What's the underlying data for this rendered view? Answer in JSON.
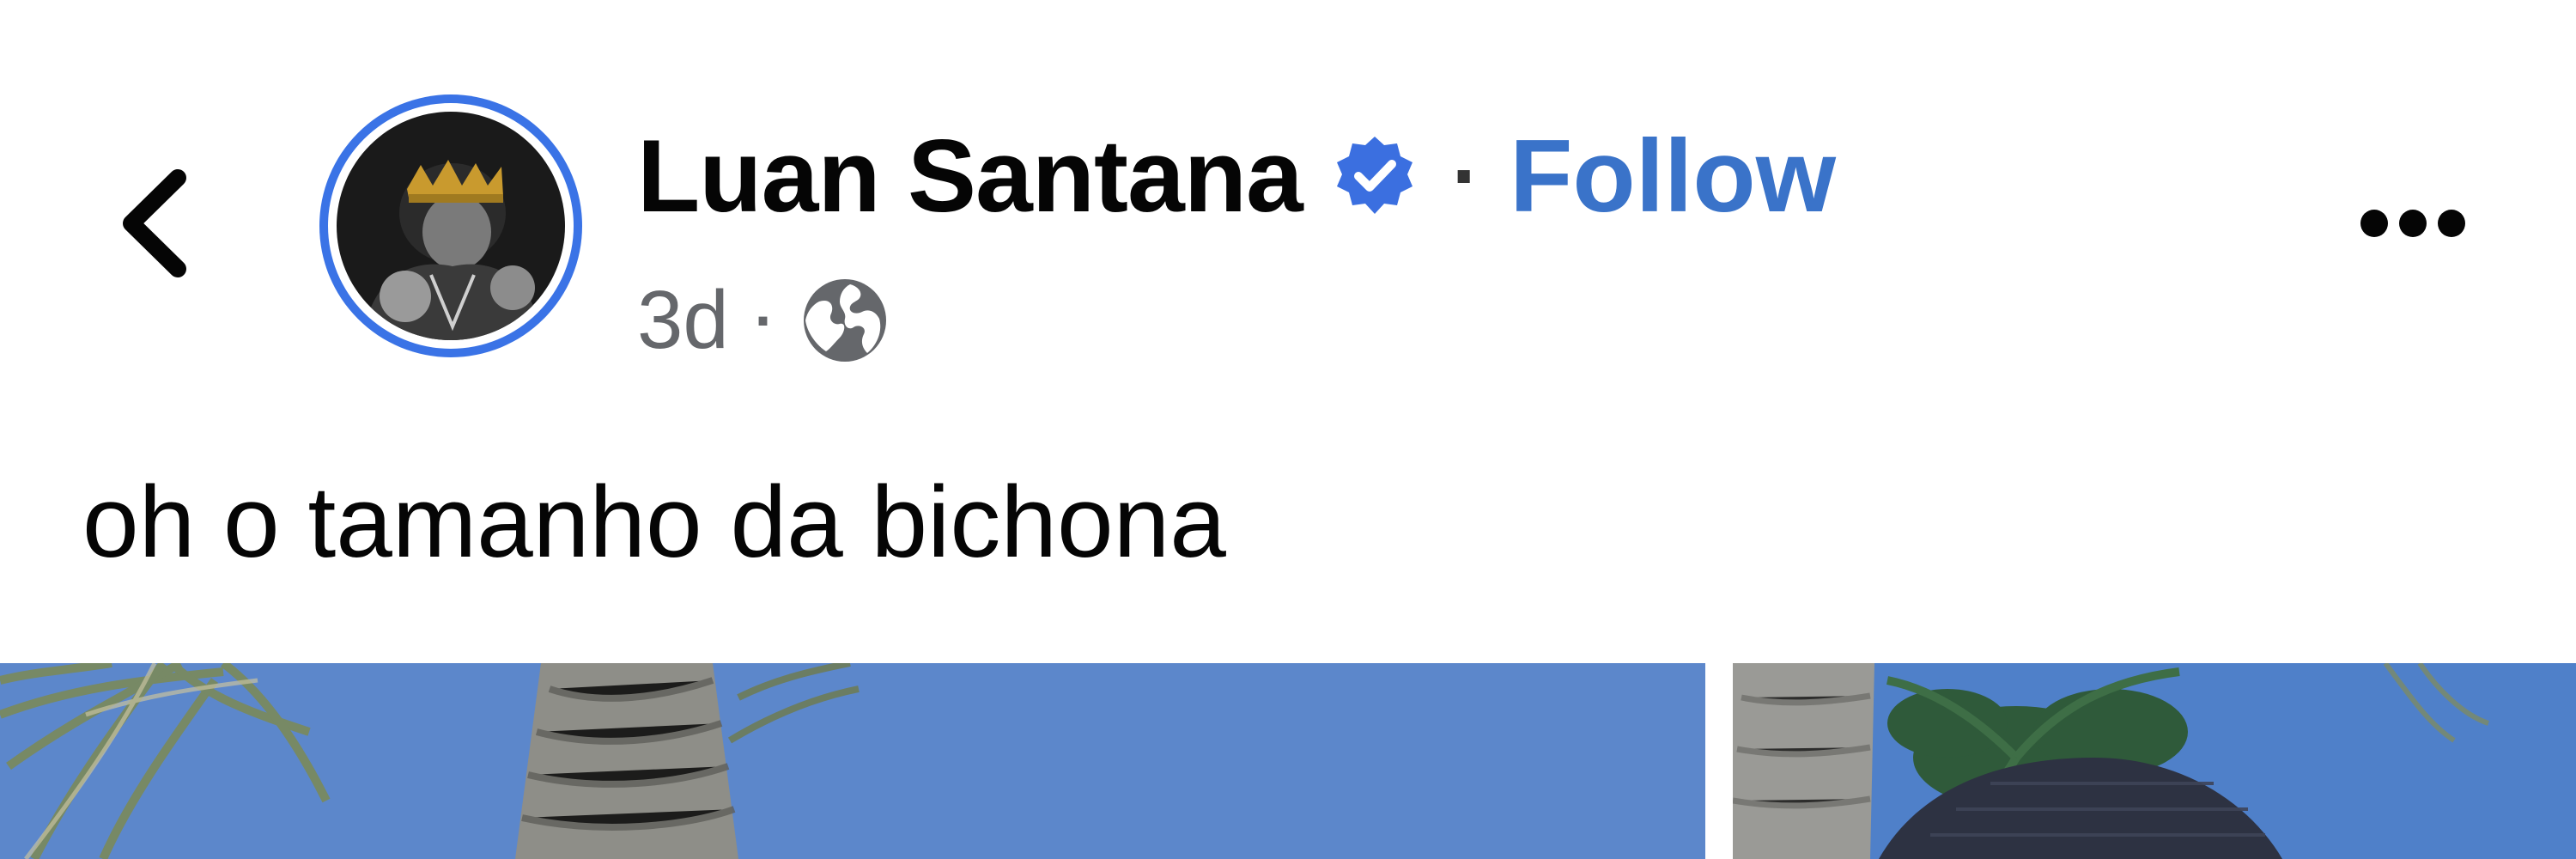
{
  "post": {
    "author_name": "Luan Santana",
    "follow_label": "Follow",
    "separator": "·",
    "time": "3d",
    "caption": "oh o tamanho da bichona"
  },
  "icons": {
    "back": "chevron-left-icon",
    "verified": "verified-badge-icon",
    "privacy": "globe-icon",
    "more": "more-horizontal-icon"
  },
  "colors": {
    "accent": "#3a73c9",
    "avatar_ring": "#3a73e6",
    "secondary_text": "#65676b",
    "sky": "#4f80c9"
  }
}
